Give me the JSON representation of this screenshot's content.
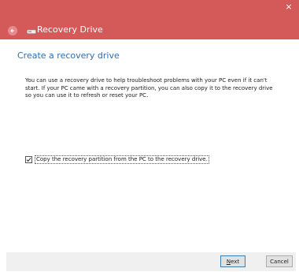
{
  "window": {
    "title": "Recovery Drive",
    "close_glyph": "×",
    "accent_color": "#d35a59"
  },
  "main": {
    "heading": "Create a recovery drive",
    "description": "You can use a recovery drive to help troubleshoot problems with your PC even if it can't start. If your PC came with a recovery partition, you can also copy it to the recovery drive so you can use it to refresh or reset your PC.",
    "checkbox": {
      "label": "Copy the recovery partition from the PC to the recovery drive.",
      "checked": true
    }
  },
  "footer": {
    "next_label_rest": "ext",
    "next_label_mnemonic": "N",
    "cancel_label": "Cancel"
  }
}
